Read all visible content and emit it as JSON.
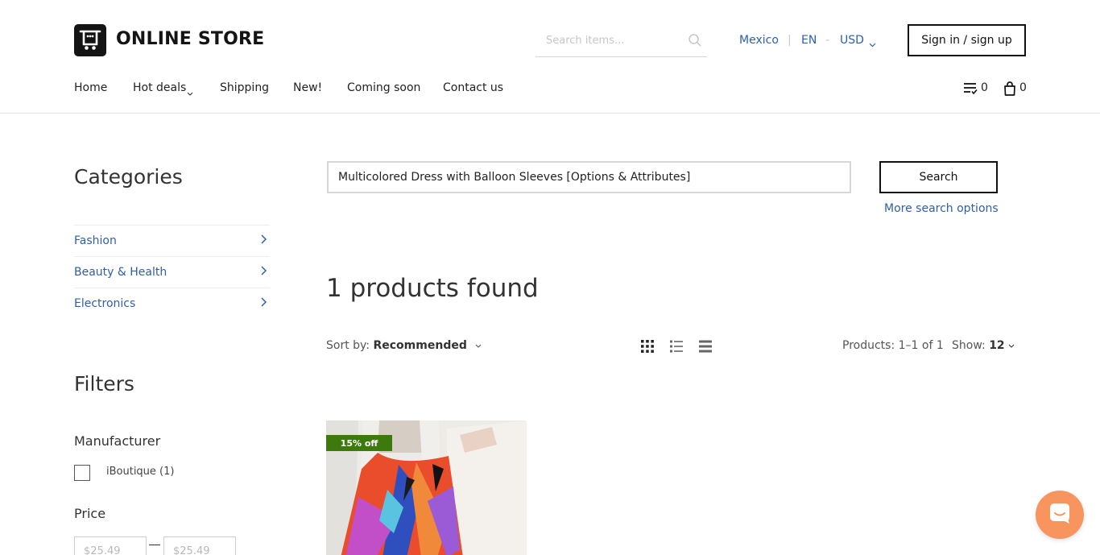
{
  "header": {
    "logo_text": "ONLINE STORE",
    "search_placeholder": "Search items...",
    "country": "Mexico",
    "language": "EN",
    "currency": "USD",
    "separator": "|",
    "dash": "-",
    "signin_label": "Sign in / sign up",
    "nav": [
      "Home",
      "Hot deals",
      "Shipping",
      "New!",
      "Coming soon",
      "Contact us"
    ],
    "wishlist_count": "0",
    "cart_count": "0"
  },
  "sidebar": {
    "categories_title": "Categories",
    "categories": [
      "Fashion",
      "Beauty & Health",
      "Electronics"
    ],
    "filters_title": "Filters",
    "manufacturer_title": "Manufacturer",
    "manufacturer_option": "iBoutique (1)",
    "price_title": "Price",
    "price_min": "$25.49",
    "price_max": "$25.49"
  },
  "main": {
    "search_value": "Multicolored Dress with Balloon Sleeves [Options & Attributes]",
    "search_button": "Search",
    "more_options": "More search options",
    "results_title": "1 products found",
    "sort_label": "Sort by:",
    "sort_value": "Recommended",
    "products_range": "Products: 1–1 of 1",
    "show_label": "Show:",
    "show_value": "12",
    "product_badge": "15% off"
  },
  "colors": {
    "link": "#2f5fa8",
    "badge": "#3d7a0e",
    "chat": "#f8955f"
  }
}
